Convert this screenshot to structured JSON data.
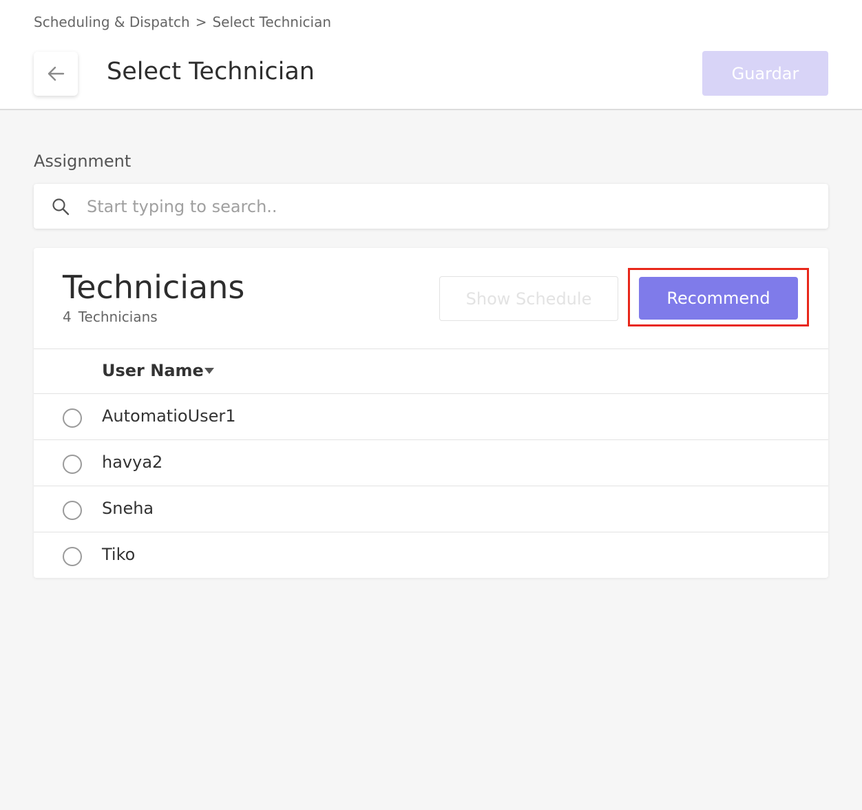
{
  "breadcrumb": {
    "parent": "Scheduling & Dispatch",
    "separator": ">",
    "current": "Select Technician"
  },
  "header": {
    "title": "Select Technician",
    "save_label": "Guardar",
    "back_icon": "arrow-left-icon"
  },
  "assignment": {
    "label": "Assignment",
    "search_placeholder": "Start typing to search..",
    "search_value": "",
    "search_icon": "search-icon"
  },
  "technicians": {
    "title": "Technicians",
    "count": "4",
    "count_label": "Technicians",
    "show_schedule_label": "Show Schedule",
    "recommend_label": "Recommend",
    "column_header": "User Name",
    "sort_icon": "caret-down-icon",
    "rows": [
      {
        "name": "AutomatioUser1",
        "selected": false
      },
      {
        "name": "havya2",
        "selected": false
      },
      {
        "name": "Sneha",
        "selected": false
      },
      {
        "name": "Tiko",
        "selected": false
      }
    ]
  },
  "colors": {
    "accent": "#7f7bea",
    "accent_disabled": "#d8d4f7",
    "highlight": "#e8271a",
    "background": "#f6f6f6"
  }
}
